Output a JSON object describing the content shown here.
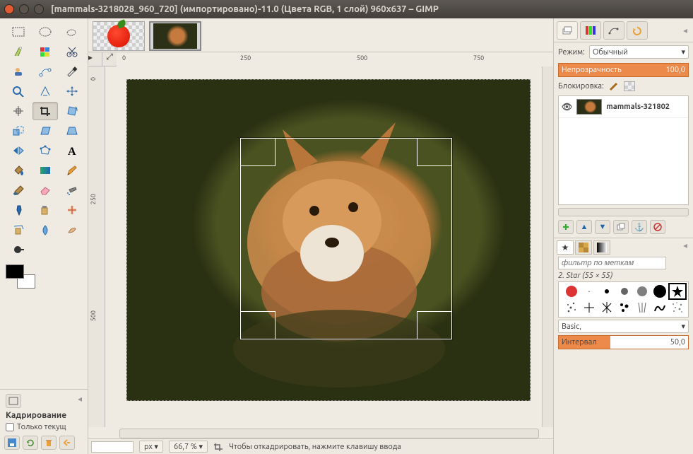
{
  "window": {
    "title": "[mammals-3218028_960_720] (импортировано)-11.0 (Цвета RGB, 1 слой) 960x637 – GIMP"
  },
  "ruler": {
    "h1": "0",
    "h2": "250",
    "h3": "500",
    "h4": "750",
    "v1": "0",
    "v2": "250",
    "v3": "500"
  },
  "status": {
    "unit": "px",
    "zoom": "66,7 %",
    "hint": "Чтобы откадрировать, нажмите клавишу ввода"
  },
  "tool_options": {
    "title": "Кадрирование",
    "only_current": "Только текущ"
  },
  "layers_panel": {
    "mode_label": "Режим:",
    "mode_value": "Обычный",
    "opacity_label": "Непрозрачность",
    "opacity_value": "100,0",
    "lock_label": "Блокировка:",
    "layer_name": "mammals-321802"
  },
  "brushes_panel": {
    "filter_placeholder": "фильтр по меткам",
    "selected_caption": "2. Star (55 × 55)",
    "preset_label": "Basic,",
    "interval_label": "Интервал",
    "interval_value": "50,0"
  }
}
